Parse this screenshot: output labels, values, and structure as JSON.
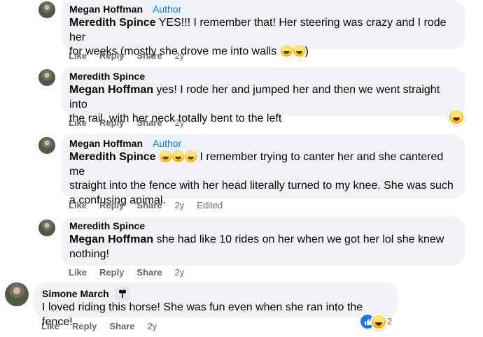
{
  "comments": [
    {
      "author": "Megan Hoffman",
      "badge": "Author",
      "tag": "Meredith Spince",
      "text_1": " YES!!! I remember that! Her steering was crazy and I rode her",
      "text_2": "for weeks (mostly she drove me into walls ",
      "text_2_end": ")",
      "actions": {
        "like": "Like",
        "reply": "Reply",
        "share": "Share",
        "time": "2y"
      }
    },
    {
      "author": "Meredith Spince",
      "tag": "Megan Hoffman",
      "text_1": " yes! I rode her and jumped her and then we went straight into",
      "text_2": "the rail..with her neck totally bent to the left",
      "actions": {
        "like": "Like",
        "reply": "Reply",
        "share": "Share",
        "time": "2y"
      },
      "reaction": "haha-icon"
    },
    {
      "author": "Megan Hoffman",
      "badge": "Author",
      "tag": "Meredith Spince",
      "text_1": " I remember trying to canter her and she cantered me",
      "text_2": "straight into the fence with her head literally turned to my knee. She was such",
      "text_3": "a confusing animal.",
      "actions": {
        "like": "Like",
        "reply": "Reply",
        "share": "Share",
        "time": "2y",
        "edited": "Edited"
      }
    },
    {
      "author": "Meredith Spince",
      "tag": "Megan Hoffman",
      "text_1": " she had like 10 rides on her when we got her lol she knew",
      "text_2": "nothing!",
      "actions": {
        "like": "Like",
        "reply": "Reply",
        "share": "Share",
        "time": "2y"
      }
    },
    {
      "author": "Simone March",
      "badge_icon": "fan-badge-icon",
      "text_1": "I loved riding this horse! She was fun even when she ran into the fence!",
      "actions": {
        "like": "Like",
        "reply": "Reply",
        "share": "Share",
        "time": "2y"
      },
      "reactions": {
        "icons": [
          "like-icon",
          "haha-icon"
        ],
        "count": "2"
      }
    }
  ],
  "colors": {
    "bubble": "#f0f2f5",
    "link_blue": "#1b74e4",
    "muted": "#65676b",
    "like_blue": "#1877f2"
  }
}
